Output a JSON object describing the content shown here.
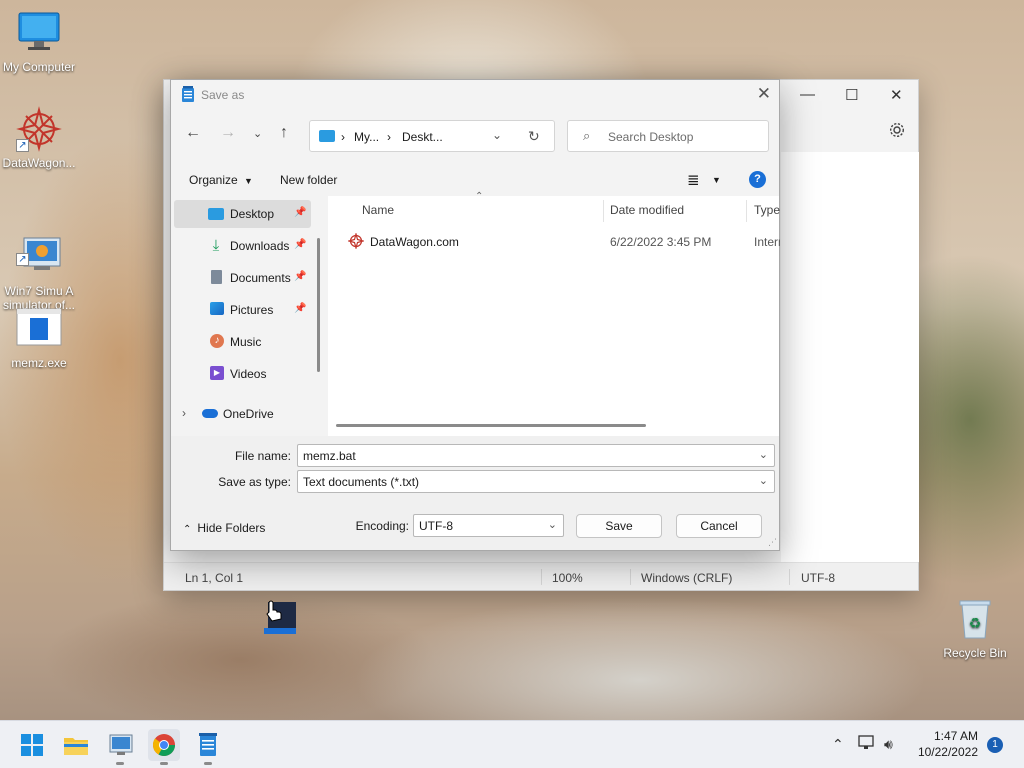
{
  "desktop": {
    "icons": [
      {
        "label": "My Computer"
      },
      {
        "label": "DataWagon..."
      },
      {
        "label": "Win7 Simu   A\nsimulator of..."
      },
      {
        "label": "memz.exe"
      }
    ],
    "recycle_bin": "Recycle Bin"
  },
  "notepad": {
    "status": {
      "position": "Ln 1, Col 1",
      "zoom": "100%",
      "line_endings": "Windows (CRLF)",
      "encoding": "UTF-8"
    }
  },
  "dialog": {
    "title": "Save as",
    "address": {
      "part1": "My...",
      "part2": "Deskt..."
    },
    "search_placeholder": "Search Desktop",
    "toolbar": {
      "organize": "Organize",
      "new_folder": "New folder"
    },
    "nav": [
      {
        "label": "Desktop",
        "pinned": true
      },
      {
        "label": "Downloads",
        "pinned": true
      },
      {
        "label": "Documents",
        "pinned": true
      },
      {
        "label": "Pictures",
        "pinned": true
      },
      {
        "label": "Music",
        "pinned": false
      },
      {
        "label": "Videos",
        "pinned": false
      },
      {
        "label": "OneDrive",
        "pinned": false
      }
    ],
    "columns": {
      "name": "Name",
      "date": "Date modified",
      "type": "Type"
    },
    "files": [
      {
        "name": "DataWagon.com",
        "date": "6/22/2022 3:45 PM",
        "type": "Intern"
      }
    ],
    "file_name_label": "File name:",
    "file_name_value": "memz.bat",
    "save_type_label": "Save as type:",
    "save_type_value": "Text documents (*.txt)",
    "hide_folders": "Hide Folders",
    "encoding_label": "Encoding:",
    "encoding_value": "UTF-8",
    "save": "Save",
    "cancel": "Cancel"
  },
  "taskbar": {
    "time": "1:47 AM",
    "date": "10/22/2022",
    "notifications": "1"
  },
  "colors": {
    "accent": "#1a5fb4",
    "folder_blue": "#2a9be0"
  }
}
